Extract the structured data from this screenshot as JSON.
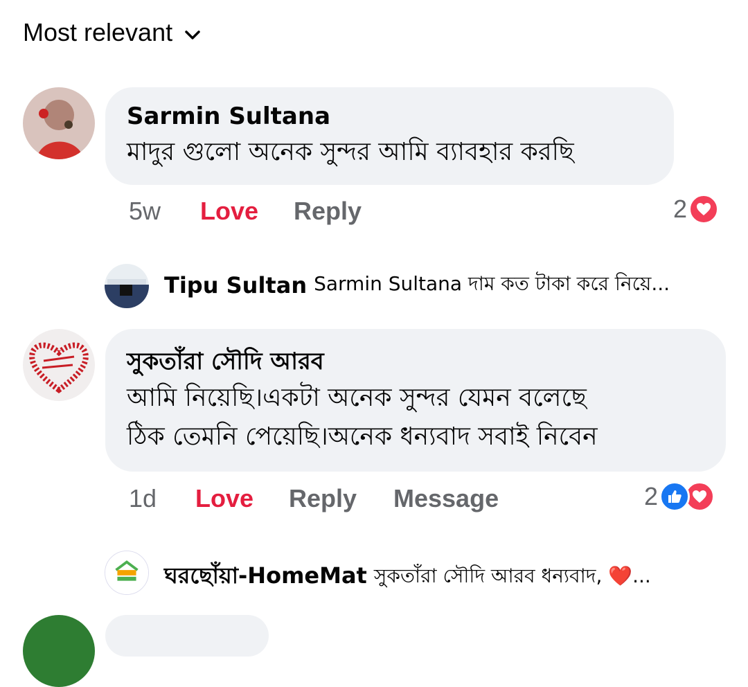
{
  "sort": {
    "label": "Most relevant"
  },
  "comments": [
    {
      "author": "Sarmin Sultana",
      "text_lines": [
        "মাদুর গুলো অনেক সুন্দর আমি ব্যাবহার করছি"
      ],
      "time": "5w",
      "love_label": "Love",
      "reply_label": "Reply",
      "reaction_count": "2",
      "reply": {
        "author": "Tipu Sultan",
        "text": "Sarmin Sultana দাম কত টাকা করে নিয়ে..."
      }
    },
    {
      "author": "সুকতাঁরা সৌদি আরব",
      "text_lines": [
        "আমি নিয়েছি।একটা অনেক সুন্দর যেমন বলেছে",
        "ঠিক তেমনি পেয়েছি।অনেক ধন্যবাদ সবাই নিবেন"
      ],
      "time": "1d",
      "love_label": "Love",
      "reply_label": "Reply",
      "message_label": "Message",
      "reaction_count": "2",
      "reply": {
        "author": "ঘরছোঁয়া-HomeMat",
        "text": "সুকতাঁরা সৌদি আরব ধন্যবাদ, ❤️..."
      }
    }
  ],
  "colors": {
    "bubble": "#f0f2f5",
    "love": "#e41e3f",
    "muted": "#65676b",
    "like_blue": "#1877f2",
    "heart_red": "#f33e58"
  }
}
